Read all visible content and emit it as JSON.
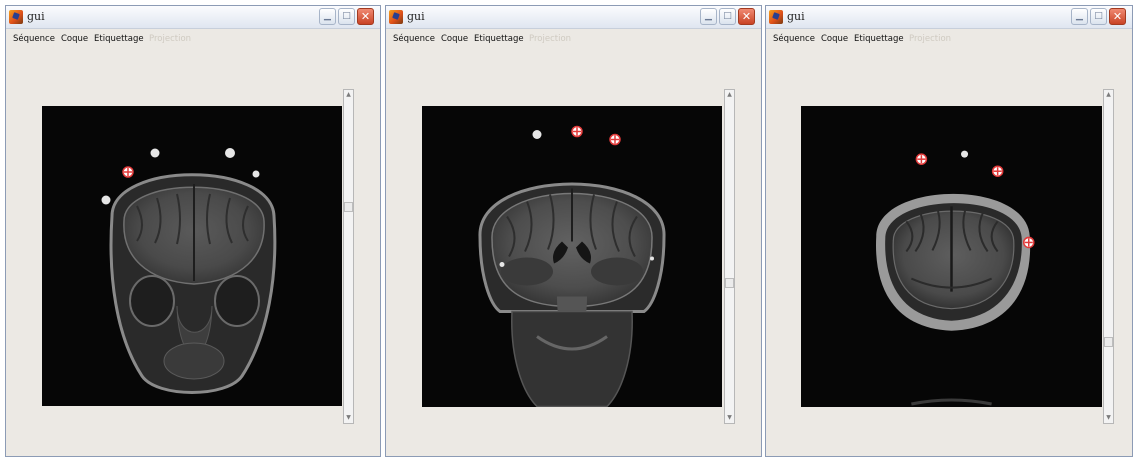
{
  "windows": [
    {
      "title": "gui",
      "menu": [
        "Séquence",
        "Coque",
        "Etiquettage",
        "Projection"
      ],
      "view": "coronal-anterior",
      "controls": {
        "minimize": "minimize",
        "maximize": "maximize",
        "close": "close"
      }
    },
    {
      "title": "gui",
      "menu": [
        "Séquence",
        "Coque",
        "Etiquettage",
        "Projection"
      ],
      "view": "coronal-posterior",
      "controls": {
        "minimize": "minimize",
        "maximize": "maximize",
        "close": "close"
      }
    },
    {
      "title": "gui",
      "menu": [
        "Séquence",
        "Coque",
        "Etiquettage",
        "Projection"
      ],
      "view": "posterior-section",
      "controls": {
        "minimize": "minimize",
        "maximize": "maximize",
        "close": "close"
      }
    }
  ],
  "menu_state": {
    "disabled_item": "Projection"
  },
  "icons": {
    "app": "matlab-logo-icon",
    "minimize": "minimize-icon",
    "maximize": "maximize-icon",
    "close": "close-icon",
    "scroll_up": "arrow-up-icon",
    "scroll_down": "arrow-down-icon"
  },
  "scroll": {
    "w1_thumb_fraction": 0.35,
    "w2_thumb_fraction": 0.58,
    "w3_thumb_fraction": 0.78
  },
  "colors": {
    "window_bg": "#ece9e4",
    "close_button": "#d3502f",
    "marker": "#e23a3a",
    "image_bg": "#060606"
  }
}
